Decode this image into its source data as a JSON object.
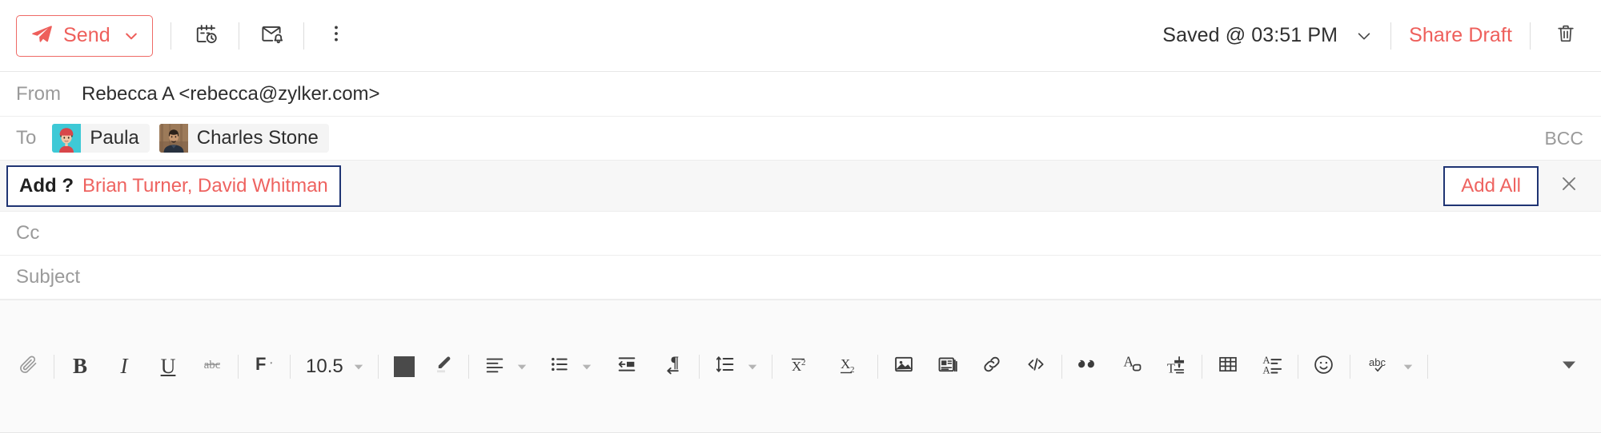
{
  "toolbar": {
    "send_label": "Send",
    "send_caret_icon": "chevron-down-icon",
    "schedule_send_icon": "calendar-clock-icon",
    "reminder_icon": "mail-bell-icon",
    "more_options_icon": "vertical-ellipsis-icon",
    "saved_status": "Saved @ 03:51 PM",
    "saved_caret_icon": "chevron-down-icon",
    "share_draft_label": "Share Draft",
    "delete_icon": "trash-icon",
    "accent_color": "#ee5f5b"
  },
  "fields": {
    "from_label": "From",
    "from_value": "Rebecca A <rebecca@zylker.com>",
    "to_label": "To",
    "recipients": [
      {
        "name": "Paula",
        "avatar_icon": "avatar-female-teal"
      },
      {
        "name": "Charles Stone",
        "avatar_icon": "avatar-male-photo"
      }
    ],
    "bcc_label": "BCC",
    "cc_label": "Cc",
    "cc_value": "",
    "subject_label": "Subject",
    "subject_value": ""
  },
  "suggestion": {
    "add_label": "Add ?",
    "names": "Brian Turner, David Whitman",
    "add_all_label": "Add All",
    "close_icon": "close-icon",
    "name_color": "#ee6360",
    "focus_border_color": "#1f3473"
  },
  "format_toolbar": {
    "attach_icon": "paperclip-icon",
    "bold_label": "B",
    "italic_label": "I",
    "underline_label": "U",
    "strikethrough_icon": "strikethrough-icon",
    "font_family_icon": "font-family-icon",
    "font_size_value": "10.5",
    "font_size_caret_icon": "chevron-down-icon",
    "text_color_icon": "text-color-swatch-icon",
    "highlight_icon": "highlighter-icon",
    "align_icon": "align-left-icon",
    "align_caret_icon": "chevron-down-icon",
    "bullet_list_icon": "bullet-list-icon",
    "bullet_caret_icon": "chevron-down-icon",
    "outdent_icon": "outdent-icon",
    "text_direction_icon": "paragraph-direction-icon",
    "line_spacing_icon": "line-spacing-icon",
    "line_spacing_caret_icon": "chevron-down-icon",
    "superscript_icon": "superscript-icon",
    "subscript_icon": "subscript-icon",
    "insert_image_icon": "image-icon",
    "insert_layout_icon": "layout-icon",
    "insert_link_icon": "link-icon",
    "code_icon": "code-icon",
    "quote_icon": "quote-icon",
    "clear_format_icon": "clear-formatting-icon",
    "format_painter_icon": "format-painter-icon",
    "table_icon": "table-icon",
    "translate_icon": "translate-icon",
    "emoji_icon": "emoji-icon",
    "spellcheck_icon": "spellcheck-icon",
    "spellcheck_caret_icon": "chevron-down-icon",
    "collapse_icon": "caret-down-filled-icon"
  }
}
